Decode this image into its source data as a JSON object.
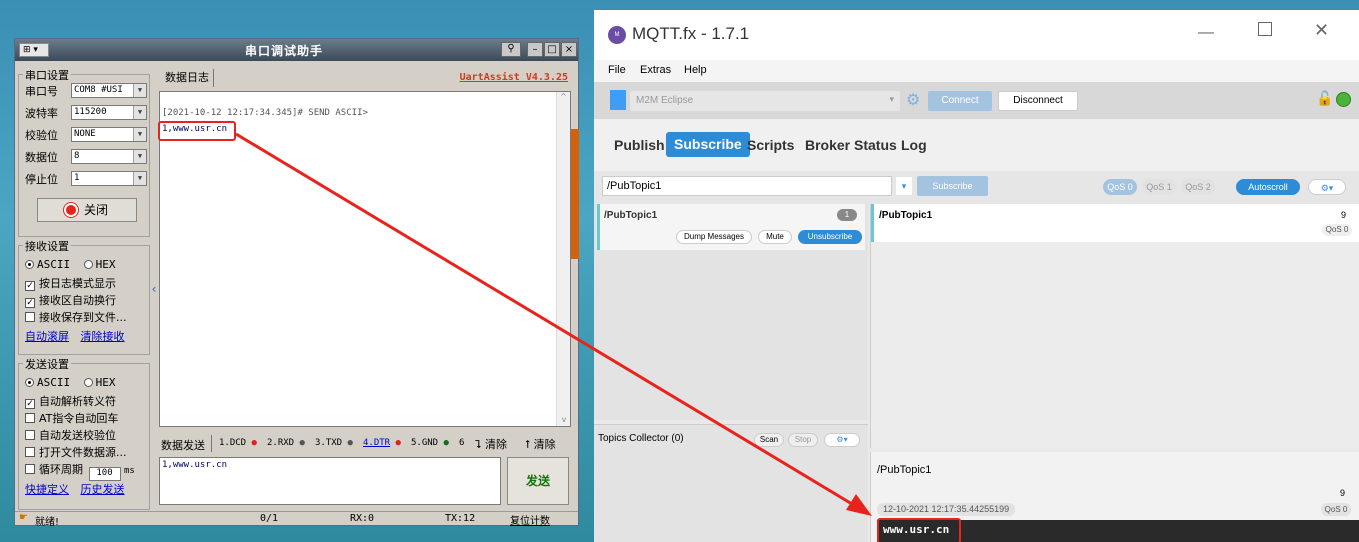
{
  "uart": {
    "title": "串口调试助手",
    "version": "UartAssist V4.3.25",
    "tab_log": "数据日志",
    "serial_settings": {
      "legend": "串口设置",
      "fields": [
        {
          "label": "串口号",
          "value": "COM8 #USI"
        },
        {
          "label": "波特率",
          "value": "115200"
        },
        {
          "label": "校验位",
          "value": "NONE"
        },
        {
          "label": "数据位",
          "value": "8"
        },
        {
          "label": "停止位",
          "value": "1"
        }
      ],
      "close_label": "关闭"
    },
    "recv_settings": {
      "legend": "接收设置",
      "ascii": "ASCII",
      "hex": "HEX",
      "opts": [
        "按日志模式显示",
        "接收区自动换行",
        "接收保存到文件..."
      ],
      "link1": "自动滚屏",
      "link2": "清除接收"
    },
    "send_settings": {
      "legend": "发送设置",
      "ascii": "ASCII",
      "hex": "HEX",
      "opts": [
        "自动解析转义符",
        "AT指令自动回车",
        "自动发送校验位",
        "打开文件数据源..."
      ],
      "cycle_label": "循环周期",
      "cycle_value": "100",
      "cycle_unit": "ms",
      "link1": "快捷定义",
      "link2": "历史发送"
    },
    "log_line1": "[2021-10-12 12:17:34.345]# SEND ASCII>",
    "log_line2": "1,www.usr.cn",
    "send_tab": "数据发送",
    "pins": [
      "1.DCD",
      "2.RXD",
      "3.TXD",
      "4.DTR",
      "5.GND",
      "6"
    ],
    "clear1": "清除",
    "clear2": "清除",
    "send_text": "1,www.usr.cn",
    "send_button": "发送",
    "status": {
      "ready": "就绪!",
      "count": "0/1",
      "rx": "RX:0",
      "tx": "TX:12",
      "reset": "复位计数"
    }
  },
  "mqtt": {
    "title": "MQTT.fx - 1.7.1",
    "menu": [
      "File",
      "Extras",
      "Help"
    ],
    "profile": "M2M Eclipse",
    "connect": "Connect",
    "disconnect": "Disconnect",
    "tabs": [
      "Publish",
      "Subscribe",
      "Scripts",
      "Broker Status",
      "Log"
    ],
    "active_tab": "Subscribe",
    "topic_input": "/PubTopic1",
    "subscribe_btn": "Subscribe",
    "qos": [
      "QoS 0",
      "QoS 1",
      "QoS 2"
    ],
    "autoscroll": "Autoscroll",
    "sub_item": {
      "topic": "/PubTopic1",
      "count": "1",
      "dump": "Dump Messages",
      "mute": "Mute",
      "unsub": "Unsubscribe"
    },
    "msg_list_item": {
      "topic": "/PubTopic1",
      "num": "9",
      "qos": "QoS 0"
    },
    "topics_collector": "Topics Collector (0)",
    "scan": "Scan",
    "stop": "Stop",
    "detail": {
      "topic": "/PubTopic1",
      "num": "9",
      "timestamp": "12-10-2021 12:17:35.44255199",
      "qos": "QoS 0",
      "payload": "www.usr.cn"
    }
  },
  "colors": {
    "highlight": "#e8231b",
    "accent": "#2e8bd6"
  }
}
